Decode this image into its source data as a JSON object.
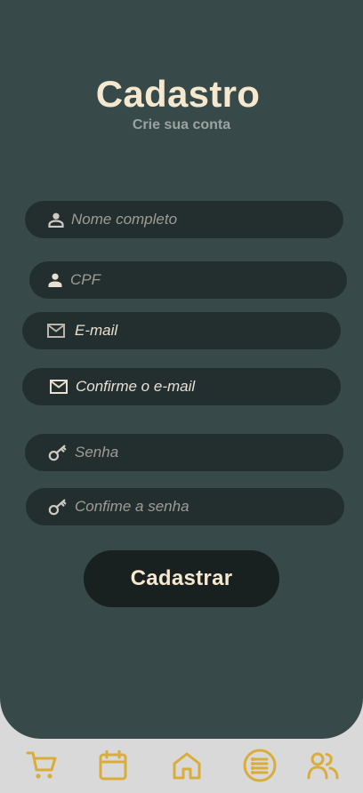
{
  "header": {
    "title": "Cadastro",
    "subtitle": "Crie sua conta"
  },
  "form": {
    "name": {
      "placeholder": "Nome completo",
      "icon": "person-icon"
    },
    "cpf": {
      "placeholder": "CPF",
      "icon": "person-icon"
    },
    "email": {
      "value": "E-mail",
      "icon": "mail-icon"
    },
    "email_confirm": {
      "value": "Confirme o e-mail",
      "icon": "mail-icon"
    },
    "password": {
      "placeholder": "Senha",
      "icon": "key-icon"
    },
    "password_confirm": {
      "placeholder": "Confime a senha",
      "icon": "key-icon"
    },
    "submit_label": "Cadastrar"
  },
  "bottom_nav": {
    "items": [
      "cart-icon",
      "calendar-icon",
      "home-icon",
      "list-icon",
      "users-icon"
    ],
    "active": "list-icon"
  },
  "colors": {
    "panel": "#374948",
    "field": "#232f2e",
    "button": "#182120",
    "accent": "#d9ad3a",
    "title": "#f6e7cf"
  }
}
